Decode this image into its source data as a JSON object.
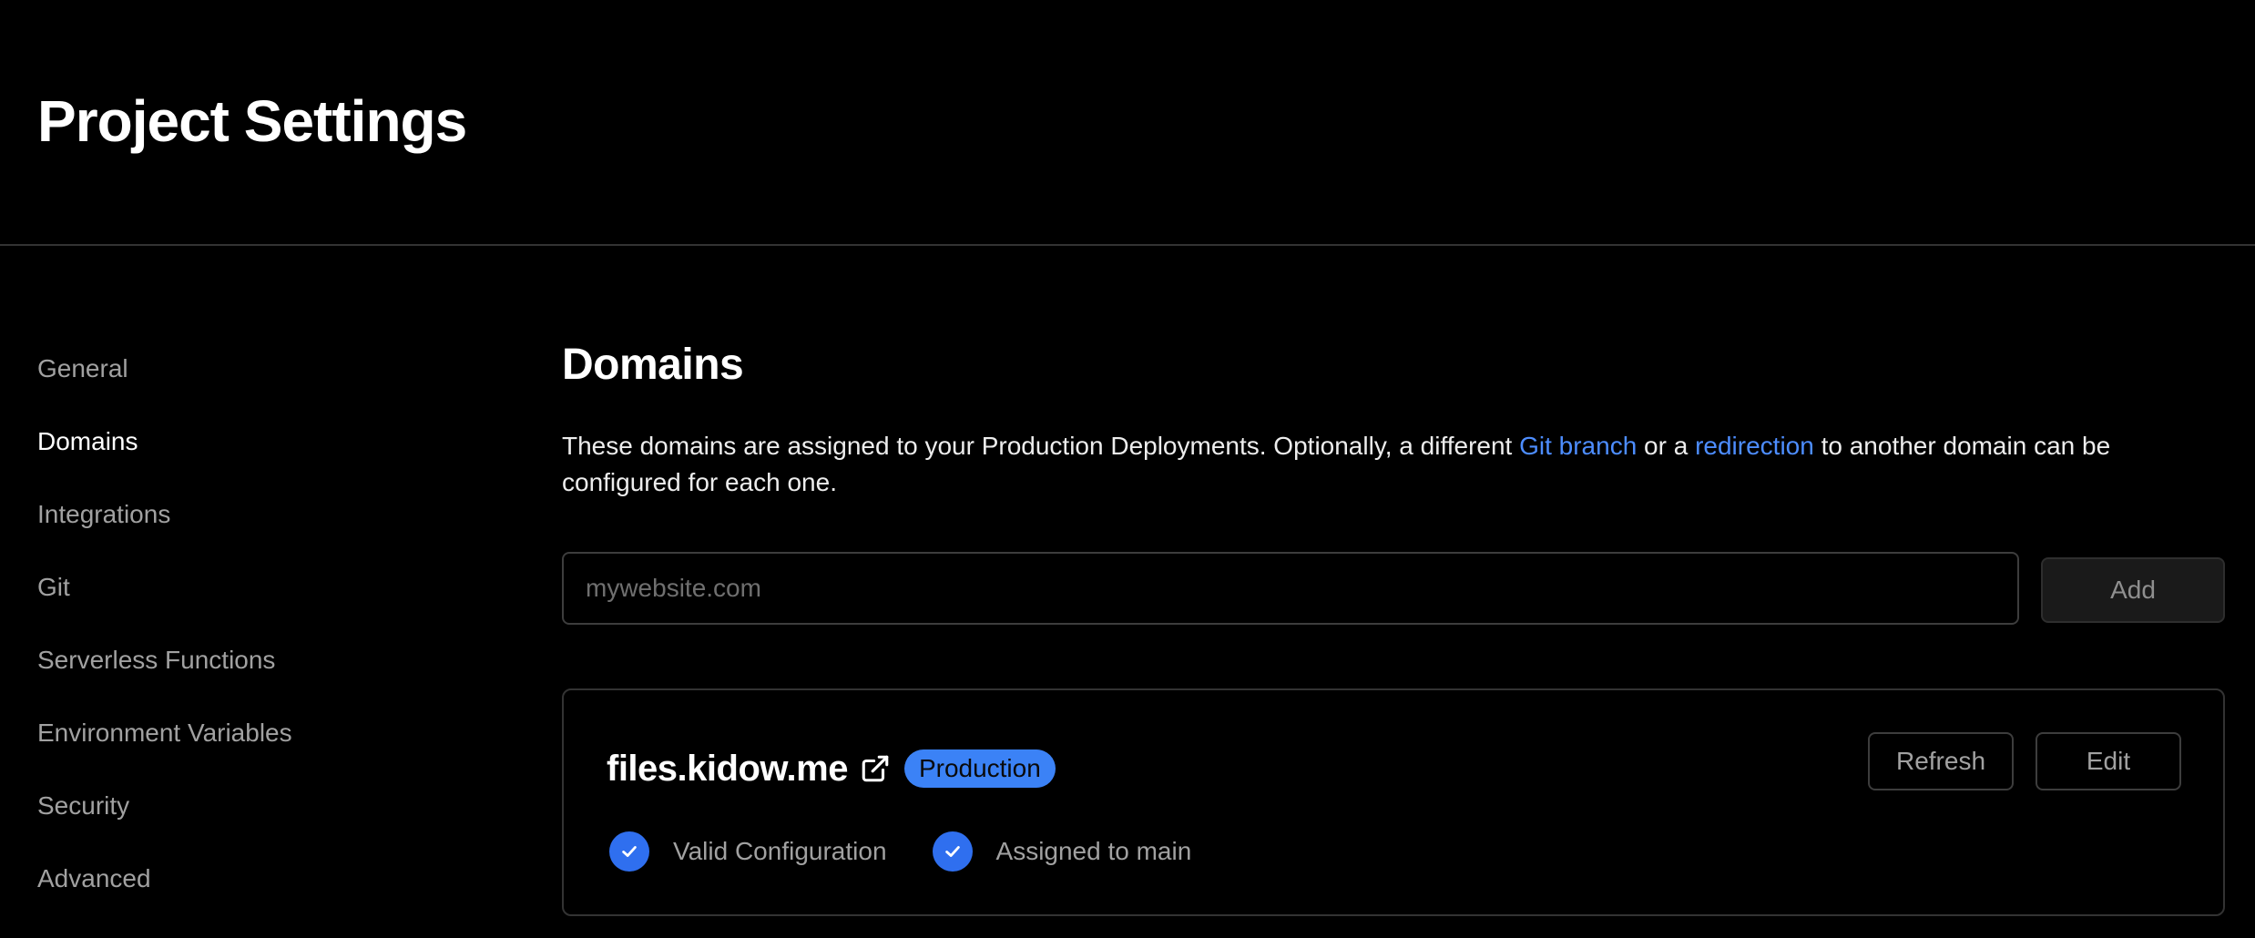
{
  "header": {
    "title": "Project Settings"
  },
  "sidebar": {
    "items": [
      {
        "label": "General",
        "active": false
      },
      {
        "label": "Domains",
        "active": true
      },
      {
        "label": "Integrations",
        "active": false
      },
      {
        "label": "Git",
        "active": false
      },
      {
        "label": "Serverless Functions",
        "active": false
      },
      {
        "label": "Environment Variables",
        "active": false
      },
      {
        "label": "Security",
        "active": false
      },
      {
        "label": "Advanced",
        "active": false
      }
    ]
  },
  "domains": {
    "title": "Domains",
    "description": {
      "part1": "These domains are assigned to your Production Deployments. Optionally, a different ",
      "link1": "Git branch",
      "part2": " or a ",
      "link2": "redirection",
      "part3": " to another domain can be configured for each one."
    },
    "input": {
      "value": "",
      "placeholder": "mywebsite.com"
    },
    "add_label": "Add",
    "card": {
      "domain": "files.kidow.me",
      "badge": "Production",
      "refresh_label": "Refresh",
      "edit_label": "Edit",
      "statuses": [
        {
          "label": "Valid Configuration",
          "icon": "check-icon"
        },
        {
          "label": "Assigned to main",
          "icon": "check-icon"
        }
      ]
    }
  },
  "colors": {
    "background": "#000000",
    "link": "#4d8dff",
    "badge": "#3b82f6",
    "check": "#2f6fef",
    "muted_text": "#a1a1a1"
  }
}
